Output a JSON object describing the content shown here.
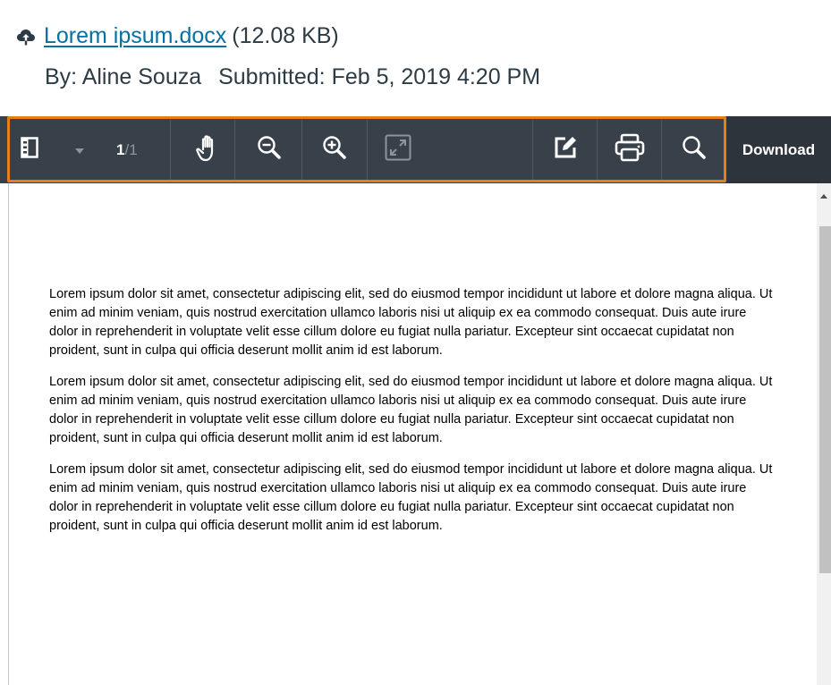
{
  "file": {
    "icon": "cloud-upload-icon",
    "name": "Lorem ipsum.docx",
    "size": "(12.08 KB)"
  },
  "submission": {
    "by_label": "By:",
    "author": "Aline Souza",
    "submitted_label": "Submitted:",
    "submitted_date": "Feb 5, 2019 4:20 PM"
  },
  "toolbar": {
    "highlight_color": "#e77f16",
    "background_color": "#38414a",
    "page_current": "1",
    "page_separator": "/",
    "page_total": "1",
    "download_label": "Download",
    "icons": [
      "sidebar-toggle-icon",
      "chevron-down-icon",
      "pan-hand-icon",
      "zoom-out-icon",
      "zoom-in-icon",
      "fullscreen-icon",
      "annotate-icon",
      "print-icon",
      "search-icon"
    ]
  },
  "document": {
    "paragraphs": [
      "Lorem ipsum dolor sit amet, consectetur adipiscing elit, sed do eiusmod tempor incididunt ut labore et dolore magna aliqua. Ut enim ad minim veniam, quis nostrud exercitation ullamco laboris nisi ut aliquip ex ea commodo consequat. Duis aute irure dolor in reprehenderit in voluptate velit esse cillum dolore eu fugiat nulla pariatur. Excepteur sint occaecat cupidatat non proident, sunt in culpa qui officia deserunt mollit anim id est laborum.",
      "Lorem ipsum dolor sit amet, consectetur adipiscing elit, sed do eiusmod tempor incididunt ut labore et dolore magna aliqua. Ut enim ad minim veniam, quis nostrud exercitation ullamco laboris nisi ut aliquip ex ea commodo consequat. Duis aute irure dolor in reprehenderit in voluptate velit esse cillum dolore eu fugiat nulla pariatur. Excepteur sint occaecat cupidatat non proident, sunt in culpa qui officia deserunt mollit anim id est laborum.",
      "Lorem ipsum dolor sit amet, consectetur adipiscing elit, sed do eiusmod tempor incididunt ut labore et dolore magna aliqua. Ut enim ad minim veniam, quis nostrud exercitation ullamco laboris nisi ut aliquip ex ea commodo consequat. Duis aute irure dolor in reprehenderit in voluptate velit esse cillum dolore eu fugiat nulla pariatur. Excepteur sint occaecat cupidatat non proident, sunt in culpa qui officia deserunt mollit anim id est laborum."
    ]
  }
}
